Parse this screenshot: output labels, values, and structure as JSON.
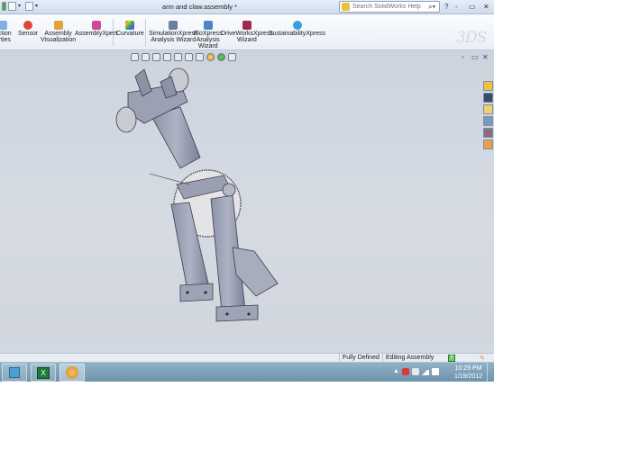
{
  "window": {
    "title": "arm and claw.assembly *",
    "search_placeholder": "Search SolidWorks Help",
    "controls": [
      "?",
      "-",
      "▭",
      "✕"
    ]
  },
  "ribbon": {
    "items": [
      {
        "label_line1": "ection",
        "label_line2": "erties",
        "icon": "section-properties-icon",
        "color": "#7fb0e0"
      },
      {
        "label_line1": "Sensor",
        "label_line2": "",
        "icon": "sensor-icon",
        "color": "#d94a3a"
      },
      {
        "label_line1": "Assembly",
        "label_line2": "Visualization",
        "icon": "assembly-visualization-icon",
        "color": "#e2a23a"
      },
      {
        "label_line1": "AssemblyXpert",
        "label_line2": "",
        "icon": "assemblyxpert-icon",
        "color": "#d04a9a"
      },
      {
        "label_line1": "Curvature",
        "label_line2": "",
        "icon": "curvature-icon",
        "color": "#7a56c8"
      },
      {
        "label_line1": "SimulationXpress",
        "label_line2": "Analysis Wizard",
        "icon": "simulationxpress-icon",
        "color": "#6a7da0"
      },
      {
        "label_line1": "FloXpress",
        "label_line2": "Analysis",
        "label_line3": "Wizard",
        "icon": "floxpress-icon",
        "color": "#4a86c6"
      },
      {
        "label_line1": "DriveWorksXpress",
        "label_line2": "Wizard",
        "icon": "driveworksxpress-icon",
        "color": "#a32a4a"
      },
      {
        "label_line1": "SustainabilityXpress",
        "label_line2": "",
        "icon": "sustainabilityxpress-icon",
        "color": "#3aa0d8"
      }
    ],
    "logo": "3DS"
  },
  "viewport": {
    "view_controls": [
      "▫",
      "▭",
      "✕"
    ]
  },
  "status": {
    "state": "Fully Defined",
    "mode": "Editing Assembly",
    "help": "?"
  },
  "taskbar": {
    "time": "10:29 PM",
    "date": "1/19/2012"
  },
  "colors": {
    "accent": "#6e93ad",
    "model_gray": "#9aa0b4",
    "disc": "#e2e2e2"
  }
}
